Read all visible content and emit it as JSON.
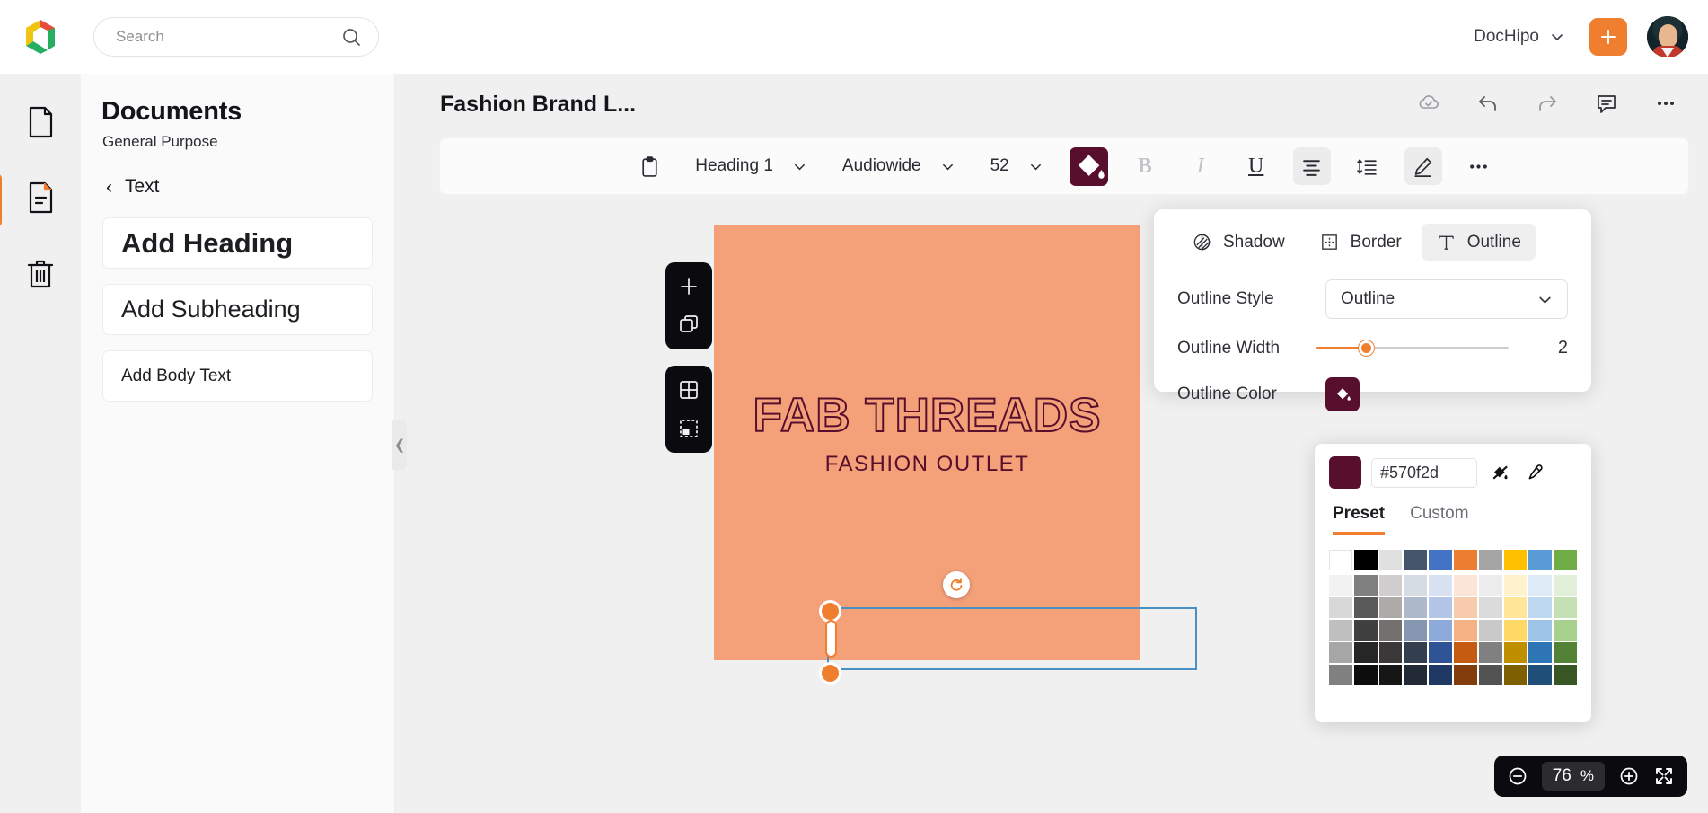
{
  "topbar": {
    "logo_name": "dochipo-logo",
    "search_placeholder": "Search",
    "search_value": "",
    "workspace": "DocHipo",
    "add_label": "+"
  },
  "rail": {
    "items": [
      {
        "name": "blank-document",
        "active": false
      },
      {
        "name": "my-documents",
        "active": true
      },
      {
        "name": "trash",
        "active": false
      }
    ]
  },
  "panel": {
    "title": "Documents",
    "subtitle": "General Purpose",
    "back_label": "Text",
    "cards": [
      {
        "label": "Add Heading",
        "style": "heading"
      },
      {
        "label": "Add Subheading",
        "style": "subheading"
      },
      {
        "label": "Add Body Text",
        "style": "body"
      }
    ]
  },
  "editor": {
    "doc_title": "Fashion Brand L...",
    "actions": [
      "cloud-saved-icon",
      "undo-icon",
      "redo-icon",
      "comment-icon",
      "more-icon"
    ]
  },
  "toolbar": {
    "clipboard_icon": "clipboard-icon",
    "text_style": "Heading 1",
    "font_family": "Audiowide",
    "font_size": "52",
    "fill_color": "#570f2d",
    "bold": "B",
    "italic": "I",
    "underline": "U",
    "align": "align-center-icon",
    "line_height": "line-height-icon",
    "effects": "effects-pencil-icon",
    "more": "..."
  },
  "canvas": {
    "background": "#f4a079",
    "logo_text": "FAB THREADS",
    "logo_subtext": "FASHION OUTLET",
    "text_color": "#570f2d"
  },
  "float_tools": {
    "group1": [
      "add-page-icon",
      "duplicate-page-icon"
    ],
    "group2": [
      "grid-icon",
      "crop-icon"
    ]
  },
  "zoom": {
    "value": "76",
    "unit": "%",
    "minus": "zoom-out-icon",
    "plus": "zoom-in-icon",
    "fullscreen": "fullscreen-icon"
  },
  "effects_popover": {
    "tabs": [
      {
        "label": "Shadow",
        "icon": "shadow-icon",
        "active": false
      },
      {
        "label": "Border",
        "icon": "border-icon",
        "active": false
      },
      {
        "label": "Outline",
        "icon": "outline-t-icon",
        "active": true
      }
    ],
    "outline_style_label": "Outline Style",
    "outline_style_value": "Outline",
    "outline_width_label": "Outline Width",
    "outline_width_value": "2",
    "outline_color_label": "Outline Color",
    "outline_color_value": "#570f2d",
    "accent": "#ef7f2e"
  },
  "color_picker": {
    "current": "#570f2d",
    "hex_value": "#570f2d",
    "hex_placeholder": "#570f2d",
    "no_color_icon": "no-color-icon",
    "eyedropper_icon": "eyedropper-icon",
    "tabs": [
      {
        "label": "Preset",
        "active": true
      },
      {
        "label": "Custom",
        "active": false
      }
    ],
    "basic_colors": [
      "#ffffff",
      "#000000",
      "#e0e0e0",
      "#44546a",
      "#4472c4",
      "#ed7d31",
      "#a5a5a5",
      "#ffc000",
      "#5b9bd5",
      "#70ad47"
    ],
    "shade_rows": [
      [
        "#f2f2f2",
        "#808080",
        "#d0cece",
        "#d6dce4",
        "#d9e2f3",
        "#fbe5d6",
        "#ededed",
        "#fff2cc",
        "#ddebf7",
        "#e2efd9"
      ],
      [
        "#d8d8d8",
        "#595959",
        "#aeaaaa",
        "#adb9ca",
        "#b4c6e7",
        "#f8cbad",
        "#dbdbdb",
        "#ffe699",
        "#bdd7ee",
        "#c5e0b3"
      ],
      [
        "#bfbfbf",
        "#404040",
        "#757070",
        "#8496b0",
        "#8eaadb",
        "#f4b183",
        "#c9c9c9",
        "#ffd966",
        "#9dc3e6",
        "#a8d08d"
      ],
      [
        "#a6a6a6",
        "#262626",
        "#3a3838",
        "#333f4f",
        "#2f5496",
        "#c55a11",
        "#808080",
        "#bf8f00",
        "#2e75b5",
        "#538135"
      ],
      [
        "#808080",
        "#0d0d0d",
        "#171616",
        "#222a35",
        "#1f3864",
        "#833c0b",
        "#525252",
        "#7f6000",
        "#1f4e79",
        "#375623"
      ]
    ]
  }
}
